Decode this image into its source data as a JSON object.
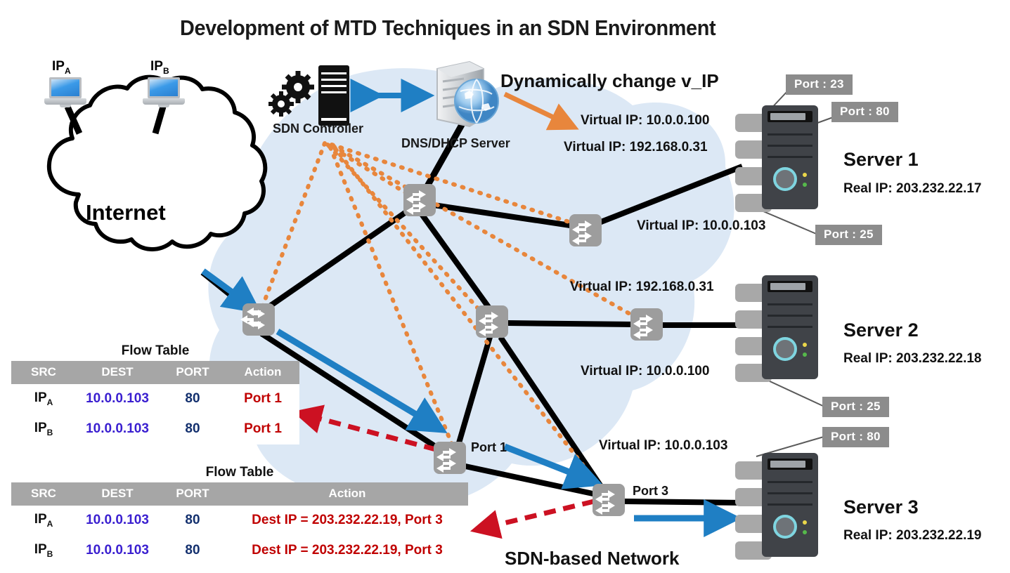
{
  "title": "Development of MTD Techniques in an SDN Environment",
  "hosts": [
    {
      "label": "IP",
      "sub": "A"
    },
    {
      "label": "IP",
      "sub": "B"
    }
  ],
  "cloud_label": "Internet",
  "sdn_network_label": "SDN-based Network",
  "controller_label": "SDN Controller",
  "dns_label": "DNS/DHCP Server",
  "dynamic_note": "Dynamically change v_IP",
  "virtual_ips": [
    {
      "id": "vip-s1-a",
      "text": "Virtual IP: 10.0.0.100"
    },
    {
      "id": "vip-s1-b",
      "text": "Virtual IP: 192.168.0.31"
    },
    {
      "id": "vip-s1-c",
      "text": "Virtual IP: 10.0.0.103"
    },
    {
      "id": "vip-s2-a",
      "text": "Virtual IP: 192.168.0.31"
    },
    {
      "id": "vip-s2-b",
      "text": "Virtual IP: 10.0.0.100"
    },
    {
      "id": "vip-s3-a",
      "text": "Virtual IP: 10.0.0.103"
    }
  ],
  "port_tags": [
    {
      "id": "pt-1",
      "text": "Port : 23"
    },
    {
      "id": "pt-2",
      "text": "Port : 80"
    },
    {
      "id": "pt-3",
      "text": "Port : 25"
    },
    {
      "id": "pt-4",
      "text": "Port : 25"
    },
    {
      "id": "pt-5",
      "text": "Port : 80"
    }
  ],
  "switch_port_labels": [
    {
      "id": "swp-1",
      "text": "Port 1"
    },
    {
      "id": "swp-3",
      "text": "Port 3"
    }
  ],
  "servers": [
    {
      "name": "Server 1",
      "real_ip": "Real IP: 203.232.22.17"
    },
    {
      "name": "Server 2",
      "real_ip": "Real IP: 203.232.22.18"
    },
    {
      "name": "Server 3",
      "real_ip": "Real IP: 203.232.22.19"
    }
  ],
  "flow_tables": [
    {
      "caption": "Flow Table",
      "columns": [
        "SRC",
        "DEST",
        "PORT",
        "Action"
      ],
      "rows": [
        {
          "src": "IP",
          "src_sub": "A",
          "dest": "10.0.0.103",
          "port": "80",
          "action": "Port 1"
        },
        {
          "src": "IP",
          "src_sub": "B",
          "dest": "10.0.0.103",
          "port": "80",
          "action": "Port 1"
        }
      ]
    },
    {
      "caption": "Flow Table",
      "columns": [
        "SRC",
        "DEST",
        "PORT",
        "Action"
      ],
      "rows": [
        {
          "src": "IP",
          "src_sub": "A",
          "dest": "10.0.0.103",
          "port": "80",
          "action": "Dest IP = 203.232.22.19,  Port 3"
        },
        {
          "src": "IP",
          "src_sub": "B",
          "dest": "10.0.0.103",
          "port": "80",
          "action": "Dest IP  = 203.232.22.19,  Port 3"
        }
      ]
    }
  ],
  "colors": {
    "cloud_fill": "#dce8f5",
    "link_black": "#000000",
    "flow_blue": "#1f7fc4",
    "reply_red": "#cc1122",
    "control_orange": "#e8863c",
    "tag_gray": "#8c8c8c",
    "header_gray": "#a6a6a6",
    "dest_blue": "#3a1fd0",
    "action_red": "#c00000"
  },
  "icons": {
    "switch": "switch-icon",
    "laptop": "laptop-icon",
    "cloud": "cloud-icon",
    "gear": "gear-icon",
    "globe": "globe-icon",
    "server_tower": "server-tower-icon"
  }
}
